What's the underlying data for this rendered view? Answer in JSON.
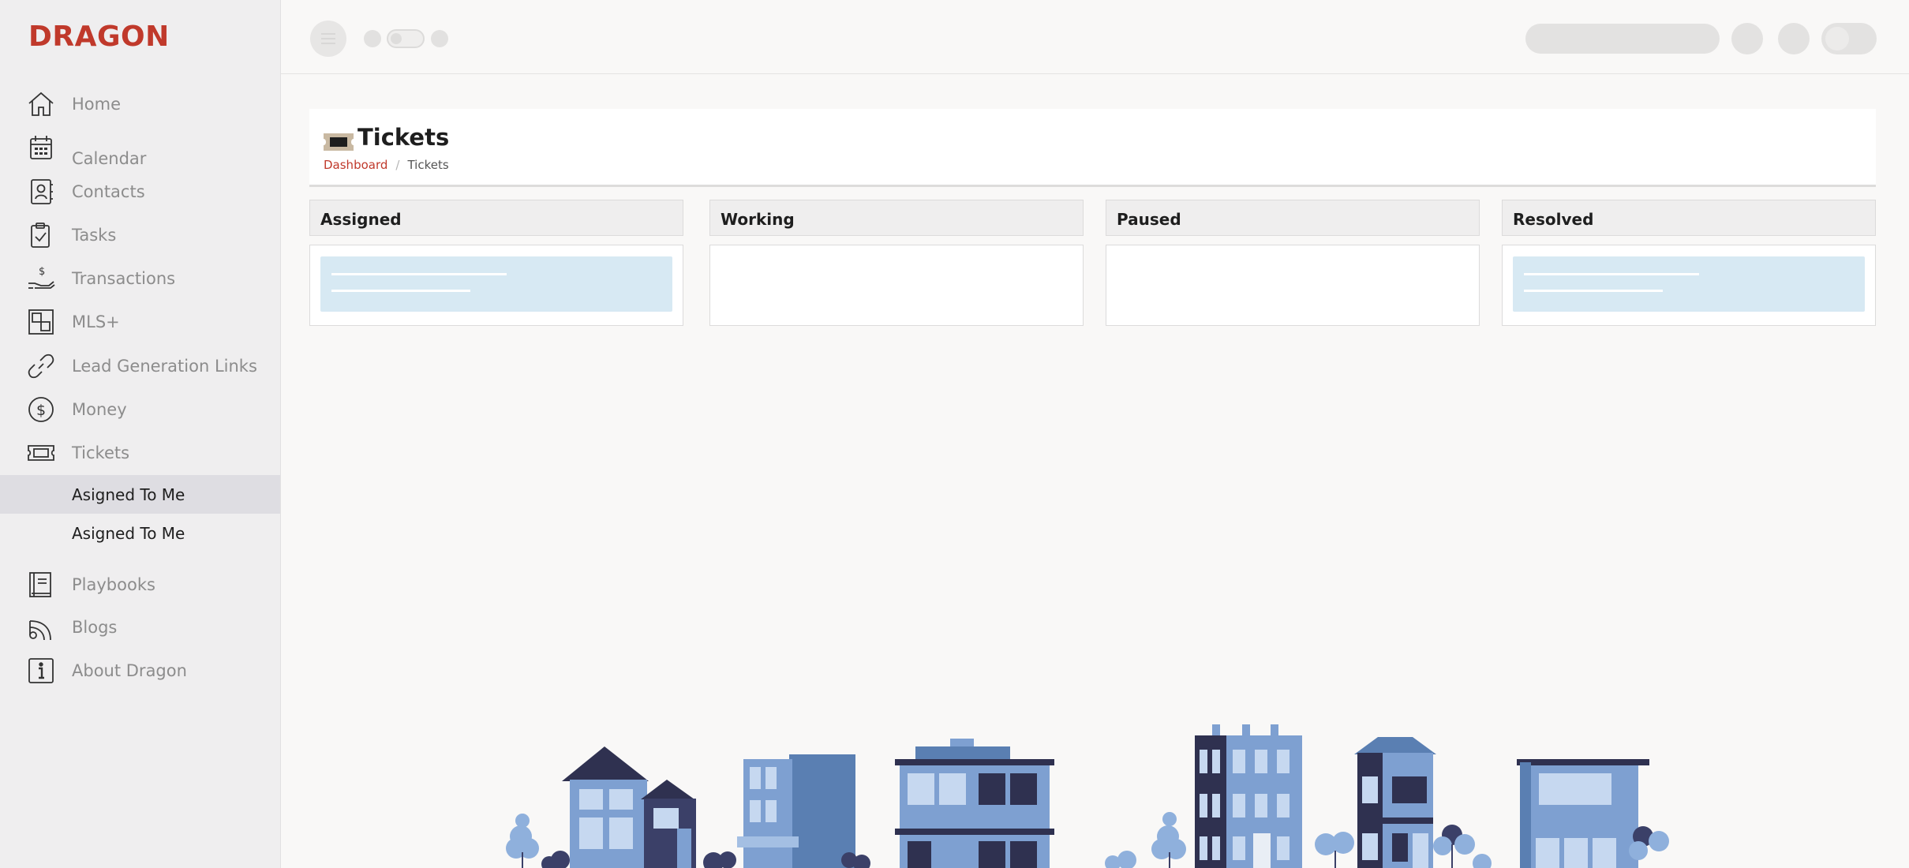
{
  "brand": {
    "name": "DRAGON",
    "color": "#c0392b"
  },
  "sidebar": {
    "items": [
      {
        "label": "Home",
        "icon": "home-icon"
      },
      {
        "label": "Calendar",
        "icon": "calendar-icon"
      },
      {
        "label": "Contacts",
        "icon": "contacts-icon"
      },
      {
        "label": "Tasks",
        "icon": "tasks-icon"
      },
      {
        "label": "Transactions",
        "icon": "transactions-icon"
      },
      {
        "label": "MLS+",
        "icon": "mls-icon"
      },
      {
        "label": "Lead Generation Links",
        "icon": "link-icon"
      },
      {
        "label": "Money",
        "icon": "money-icon"
      },
      {
        "label": "Tickets",
        "icon": "ticket-icon"
      },
      {
        "label": "Playbooks",
        "icon": "playbook-icon"
      },
      {
        "label": "Blogs",
        "icon": "blogs-icon"
      },
      {
        "label": "About Dragon",
        "icon": "info-icon"
      }
    ],
    "ticket_subitems": [
      {
        "label": "Asigned To Me",
        "active": true
      },
      {
        "label": "Asigned To Me",
        "active": false
      }
    ]
  },
  "header": {
    "title": "Tickets",
    "breadcrumb": {
      "root": "Dashboard",
      "separator": "/",
      "current": "Tickets"
    }
  },
  "board": {
    "columns": [
      {
        "title": "Assigned",
        "cards": 1
      },
      {
        "title": "Working",
        "cards": 0
      },
      {
        "title": "Paused",
        "cards": 0
      },
      {
        "title": "Resolved",
        "cards": 1
      }
    ]
  },
  "colors": {
    "accent": "#c0392b",
    "card": "#d7e9f3",
    "building": "#7ea0d1",
    "building_dark": "#3b4068"
  }
}
